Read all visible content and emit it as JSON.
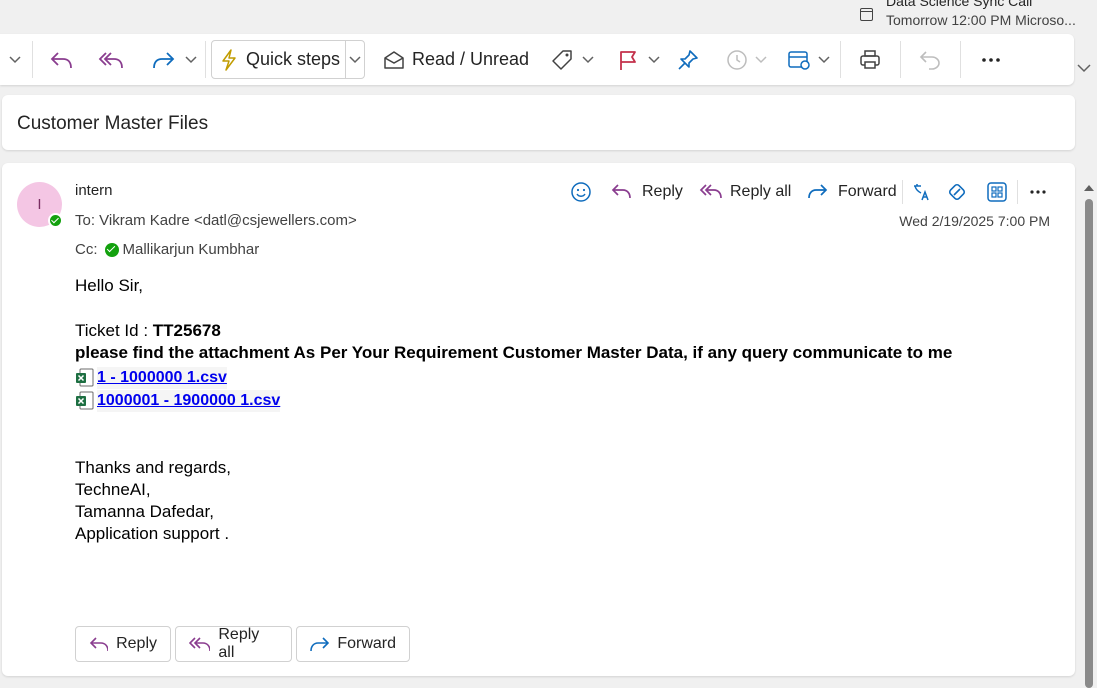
{
  "reminder": {
    "title": "Data Science Sync Call",
    "subtitle": "Tomorrow 12:00 PM Microso..."
  },
  "ribbon": {
    "quick_steps": "Quick steps",
    "read_unread": "Read / Unread"
  },
  "subject": "Customer Master Files",
  "message": {
    "avatar_initial": "I",
    "from": "intern",
    "to": "To:  Vikram Kadre <datl@csjewellers.com>",
    "cc_label": "Cc:",
    "cc_name": "Mallikarjun Kumbhar",
    "date": "Wed 2/19/2025 7:00 PM",
    "actions": {
      "reply": "Reply",
      "reply_all": "Reply all",
      "forward": "Forward"
    },
    "body": {
      "greeting": "Hello Sir,",
      "ticket_label": "Ticket Id : ",
      "ticket_id": "TT25678",
      "instruction": "please find the attachment As Per Your Requirement Customer Master Data, if any query communicate to me",
      "attachments": [
        "1 - 1000000 1.csv",
        "1000001 - 1900000 1.csv"
      ],
      "signoff": [
        "Thanks and regards,",
        "TechneAI,",
        "Tamanna Dafedar,",
        "Application support ."
      ]
    },
    "buttons": {
      "reply": "Reply",
      "reply_all": "Reply all",
      "forward": "Forward"
    }
  },
  "colors": {
    "accent_purple": "#8a3d8f",
    "accent_blue": "#0f6cbd",
    "presence_green": "#13a10e",
    "flag_red": "#c4314b"
  }
}
